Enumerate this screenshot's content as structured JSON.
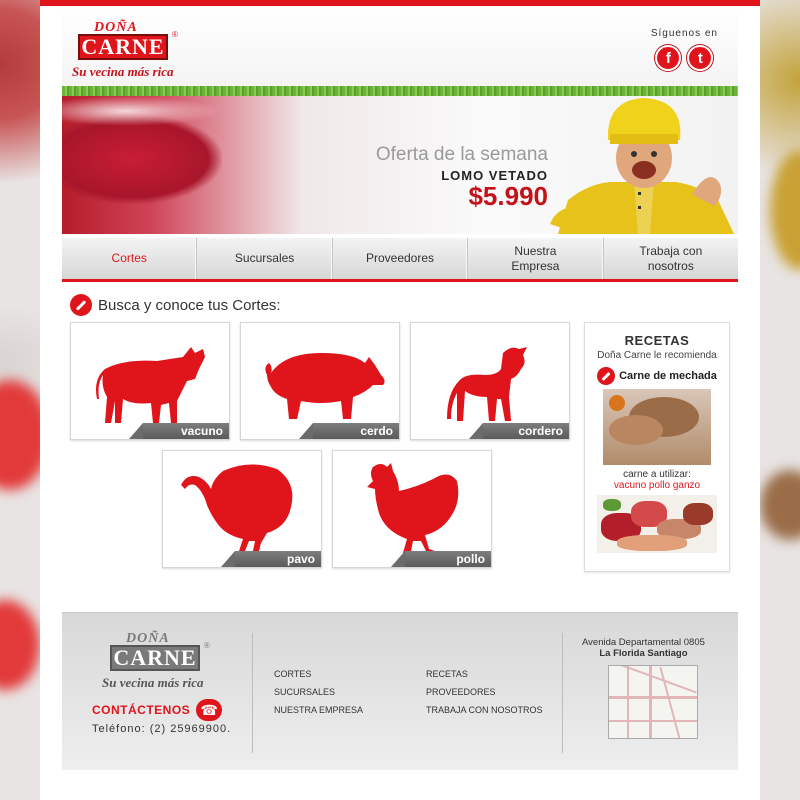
{
  "brand": {
    "top": "DOÑA",
    "name": "CARNE",
    "registered": "®",
    "tagline": "Su vecina más rica"
  },
  "social": {
    "label": "Síguenos en",
    "facebook": "f",
    "twitter": "t"
  },
  "banner": {
    "title": "Oferta de la semana",
    "product": "LOMO VETADO",
    "price": "$5.990"
  },
  "nav": [
    {
      "label": "Cortes",
      "active": true
    },
    {
      "label": "Sucursales"
    },
    {
      "label": "Proveedores"
    },
    {
      "label": "Nuestra\nEmpresa"
    },
    {
      "label": "Trabaja con\nnosotros"
    }
  ],
  "section": {
    "title": "Busca y conoce tus Cortes:"
  },
  "cuts": [
    {
      "label": "vacuno"
    },
    {
      "label": "cerdo"
    },
    {
      "label": "cordero"
    },
    {
      "label": "pavo"
    },
    {
      "label": "pollo"
    }
  ],
  "recipes": {
    "title": "RECETAS",
    "subtitle": "Doña Carne le recomienda",
    "dish": "Carne de mechada",
    "use_label": "carne a utilizar:",
    "meats": "vacuno pollo ganzo"
  },
  "footer": {
    "contact_label": "CONTÁCTENOS",
    "phone": "Teléfono: (2) 25969900.",
    "links_col1": [
      "CORTES",
      "SUCURSALES",
      "NUESTRA EMPRESA"
    ],
    "links_col2": [
      "RECETAS",
      "PROVEEDORES",
      "TRABAJA CON NOSOTROS"
    ],
    "address_line1": "Avenida Departamental 0805",
    "address_line2": "La Florida Santiago"
  },
  "colors": {
    "brand_red": "#e0141b",
    "label_gray": "#6b6b6b"
  }
}
